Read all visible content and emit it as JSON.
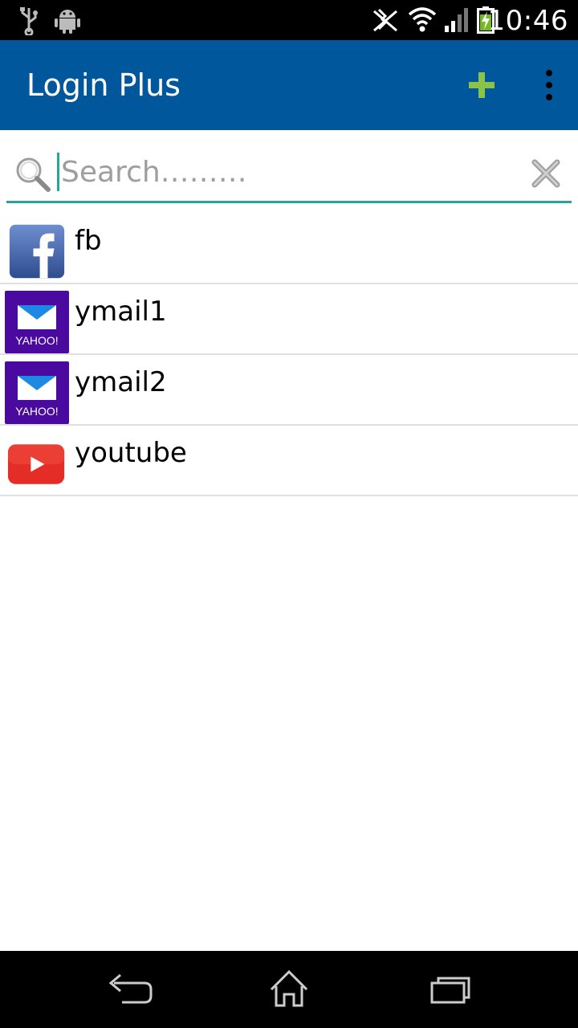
{
  "status_bar": {
    "time": "10:46",
    "icons": [
      "usb-icon",
      "android-debug-icon",
      "nfc-icon",
      "wifi-icon",
      "signal-icon",
      "battery-charging-icon"
    ]
  },
  "app_bar": {
    "title": "Login Plus",
    "actions": [
      "add-icon",
      "overflow-menu-icon"
    ]
  },
  "search": {
    "placeholder": "Search………",
    "value": ""
  },
  "accounts": [
    {
      "label": "fb",
      "icon": "facebook-icon"
    },
    {
      "label": "ymail1",
      "icon": "yahoo-mail-icon",
      "icon_text": "YAHOO!"
    },
    {
      "label": "ymail2",
      "icon": "yahoo-mail-icon",
      "icon_text": "YAHOO!"
    },
    {
      "label": "youtube",
      "icon": "youtube-icon"
    }
  ],
  "nav_bar": {
    "buttons": [
      "back-icon",
      "home-icon",
      "recents-icon"
    ]
  },
  "colors": {
    "app_bar": "#01579b",
    "accent": "#8bc34a",
    "search_underline": "#26a69a",
    "yahoo_purple": "#4a0aa0",
    "youtube_red": "#e52d27",
    "facebook_blue": "#3b5998"
  }
}
